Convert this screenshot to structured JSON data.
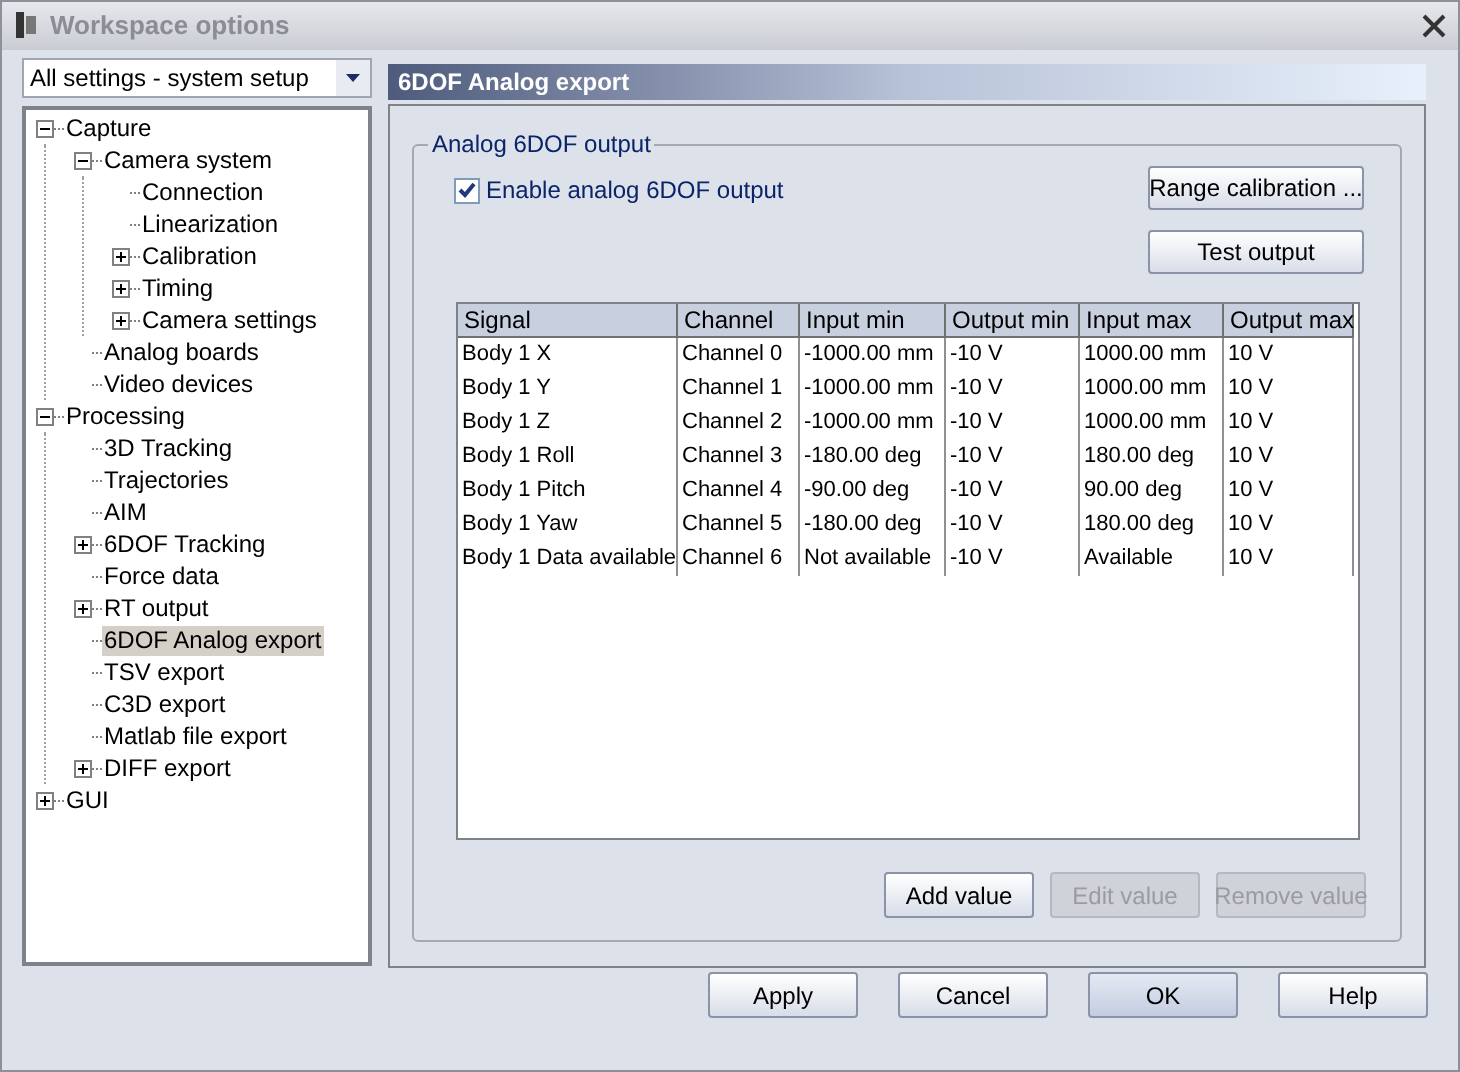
{
  "window": {
    "title": "Workspace options"
  },
  "settings_dropdown": {
    "value": "All settings - system setup"
  },
  "tree": [
    {
      "label": "Capture",
      "expanded": true,
      "selected": false,
      "children": [
        {
          "label": "Camera system",
          "expanded": true,
          "selected": false,
          "children": [
            {
              "label": "Connection",
              "selected": false
            },
            {
              "label": "Linearization",
              "selected": false
            },
            {
              "label": "Calibration",
              "expanded": false,
              "selected": false
            },
            {
              "label": "Timing",
              "expanded": false,
              "selected": false
            },
            {
              "label": "Camera settings",
              "expanded": false,
              "selected": false
            }
          ]
        },
        {
          "label": "Analog boards",
          "selected": false
        },
        {
          "label": "Video devices",
          "selected": false
        }
      ]
    },
    {
      "label": "Processing",
      "expanded": true,
      "selected": false,
      "children": [
        {
          "label": "3D Tracking",
          "selected": false
        },
        {
          "label": "Trajectories",
          "selected": false
        },
        {
          "label": "AIM",
          "selected": false
        },
        {
          "label": "6DOF Tracking",
          "expanded": false,
          "selected": false
        },
        {
          "label": "Force data",
          "selected": false
        },
        {
          "label": "RT output",
          "expanded": false,
          "selected": false
        },
        {
          "label": "6DOF Analog export",
          "selected": true
        },
        {
          "label": "TSV export",
          "selected": false
        },
        {
          "label": "C3D export",
          "selected": false
        },
        {
          "label": "Matlab file export",
          "selected": false
        },
        {
          "label": "DIFF export",
          "expanded": false,
          "selected": false
        }
      ]
    },
    {
      "label": "GUI",
      "expanded": false,
      "selected": false
    }
  ],
  "page": {
    "title": "6DOF Analog export",
    "group": {
      "title": "Analog 6DOF output",
      "enable_checkbox": {
        "label": "Enable analog 6DOF output",
        "checked": true
      },
      "buttons": [
        {
          "label": "Range calibration ...",
          "disabled": false
        },
        {
          "label": "Test output",
          "disabled": false
        }
      ],
      "table": {
        "columns": [
          "Signal",
          "Channel",
          "Input min",
          "Output min",
          "Input max",
          "Output max"
        ],
        "rows": [
          [
            "Body 1 X",
            "Channel 0",
            "-1000.00 mm",
            "-10 V",
            "1000.00 mm",
            "10 V"
          ],
          [
            "Body 1 Y",
            "Channel 1",
            "-1000.00 mm",
            "-10 V",
            "1000.00 mm",
            "10 V"
          ],
          [
            "Body 1 Z",
            "Channel 2",
            "-1000.00 mm",
            "-10 V",
            "1000.00 mm",
            "10 V"
          ],
          [
            "Body 1 Roll",
            "Channel 3",
            "-180.00 deg",
            "-10 V",
            "180.00 deg",
            "10 V"
          ],
          [
            "Body 1 Pitch",
            "Channel 4",
            "-90.00 deg",
            "-10 V",
            "90.00 deg",
            "10 V"
          ],
          [
            "Body 1 Yaw",
            "Channel 5",
            "-180.00 deg",
            "-10 V",
            "180.00 deg",
            "10 V"
          ],
          [
            "Body 1 Data available",
            "Channel 6",
            "Not available",
            "-10 V",
            "Available",
            "10 V"
          ]
        ]
      },
      "table_buttons": [
        {
          "label": "Add value",
          "disabled": false
        },
        {
          "label": "Edit value",
          "disabled": true
        },
        {
          "label": "Remove value",
          "disabled": true
        }
      ]
    }
  },
  "dialog_buttons": [
    {
      "label": "Apply",
      "default": false
    },
    {
      "label": "Cancel",
      "default": false
    },
    {
      "label": "OK",
      "default": true
    },
    {
      "label": "Help",
      "default": false
    }
  ]
}
